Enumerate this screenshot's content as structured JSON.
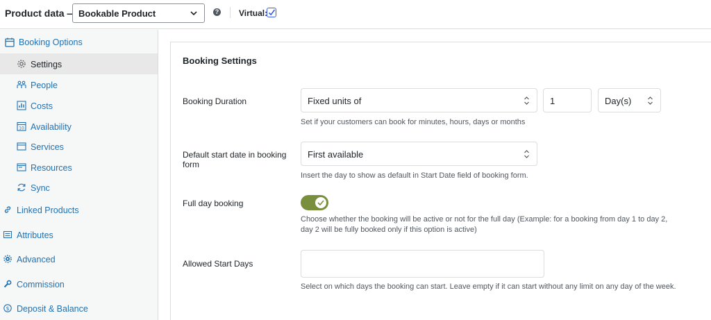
{
  "header": {
    "title": "Product data —",
    "product_type": "Bookable Product",
    "help_glyph": "?",
    "virtual_label": "Virtual:",
    "virtual_checked": true
  },
  "sidebar": {
    "items": [
      {
        "label": "Booking Options",
        "icon": "calendar-icon",
        "active": false
      },
      {
        "label": "Settings",
        "icon": "gear-icon",
        "active": true
      },
      {
        "label": "People",
        "icon": "people-icon",
        "active": false
      },
      {
        "label": "Costs",
        "icon": "chart-icon",
        "active": false
      },
      {
        "label": "Availability",
        "icon": "calendar-day-icon",
        "active": false
      },
      {
        "label": "Services",
        "icon": "services-icon",
        "active": false
      },
      {
        "label": "Resources",
        "icon": "resources-icon",
        "active": false
      },
      {
        "label": "Sync",
        "icon": "sync-icon",
        "active": false
      },
      {
        "label": "Linked Products",
        "icon": "link-icon",
        "active": false
      },
      {
        "label": "Attributes",
        "icon": "list-icon",
        "active": false
      },
      {
        "label": "Advanced",
        "icon": "gear-icon",
        "active": false
      },
      {
        "label": "Commission",
        "icon": "wrench-icon",
        "active": false
      },
      {
        "label": "Deposit & Balance",
        "icon": "dollar-icon",
        "active": false
      }
    ]
  },
  "main": {
    "title": "Booking Settings",
    "booking_duration": {
      "label": "Booking Duration",
      "type_value": "Fixed units of",
      "units_value": "1",
      "unit_value": "Day(s)",
      "description": "Set if your customers can book for minutes, hours, days or months"
    },
    "default_start": {
      "label": "Default start date in booking form",
      "value": "First available",
      "description": "Insert the day to show as default in Start Date field of booking form."
    },
    "full_day": {
      "label": "Full day booking",
      "enabled": true,
      "description": "Choose whether the booking will be active or not for the full day (Example: for a booking from day 1 to day 2, day 2 will be fully booked only if this option is active)"
    },
    "allowed_start_days": {
      "label": "Allowed Start Days",
      "value": "",
      "description": "Select on which days the booking can start. Leave empty if it can start without any limit on any day of the week."
    }
  },
  "colors": {
    "link": "#2271b1",
    "toggle_on": "#7a8f3d",
    "checkbox": "#3858e9"
  }
}
